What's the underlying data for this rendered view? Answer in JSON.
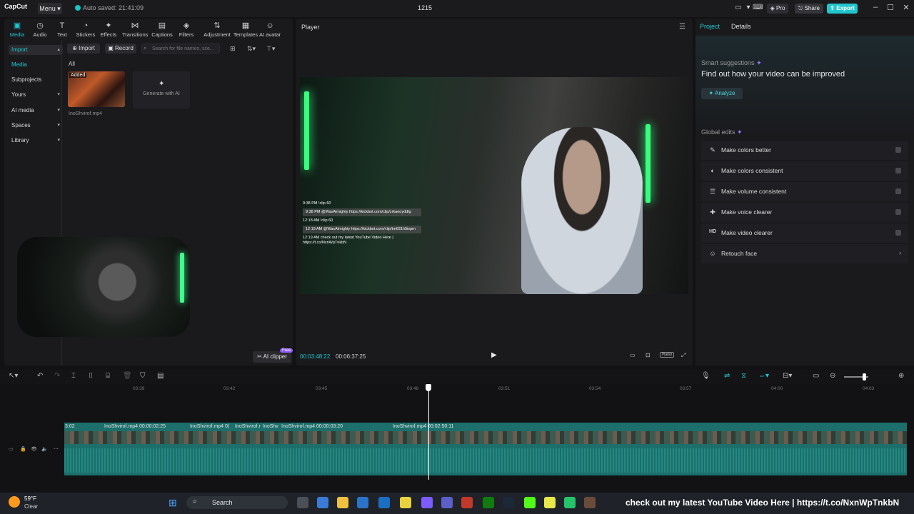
{
  "titlebar": {
    "logo": "CapCut",
    "menu": "Menu",
    "autosave": "Auto saved: 21:41:09",
    "project_name": "1215",
    "pro": "Pro",
    "share": "Share",
    "export": "Export"
  },
  "toolbar_tabs": [
    "Media",
    "Audio",
    "Text",
    "Stickers",
    "Effects",
    "Transitions",
    "Captions",
    "Filters",
    "Adjustment",
    "Templates",
    "AI avatar"
  ],
  "sidebar": {
    "items": [
      "Import",
      "Media",
      "Subprojects",
      "Yours",
      "AI media",
      "Spaces",
      "Library"
    ]
  },
  "media": {
    "import_btn": "Import",
    "record_btn": "Record",
    "search_placeholder": "Search for file names, sce...",
    "all_label": "All",
    "added_badge": "Added",
    "generate_ai": "Generate with AI",
    "file_name": "InoShvirof.mp4",
    "ai_clipper": "AI clipper",
    "free_badge": "Free"
  },
  "player": {
    "title": "Player",
    "current_time": "00:03:48:22",
    "total_time": "00:06:37:25",
    "ratio": "Ratio",
    "chat": [
      {
        "text": "9:38 PM  !clip 60",
        "boxed": false
      },
      {
        "text": "9:38 PM @WaxAlmighty https://kickbot.com/clip/zrkaeoyddlg",
        "boxed": true
      },
      {
        "text": "12:18 AM  !clip 60",
        "boxed": false
      },
      {
        "text": "12:19 AM @WaxAlmighty https://kickbot.com/clip/tm631h5isprn",
        "boxed": true
      },
      {
        "text": "12:19 AM  check out my latest YouTube Video Here | https://t.co/NxnWpTnkbN",
        "boxed": false
      }
    ]
  },
  "right_panel": {
    "tab_project": "Project",
    "tab_details": "Details",
    "smart_suggestions": "Smart suggestions",
    "find_out": "Find out how your video can be improved",
    "analyze": "Analyze",
    "global_edits": "Global edits",
    "edits": [
      {
        "icon": "✎",
        "label": "Make colors better"
      },
      {
        "icon": "◐",
        "label": "Make colors consistent"
      },
      {
        "icon": "☰",
        "label": "Make volume consistent"
      },
      {
        "icon": "✚",
        "label": "Make voice clearer"
      },
      {
        "icon": "HD",
        "label": "Make video clearer"
      },
      {
        "icon": "☺",
        "label": "Retouch face"
      }
    ]
  },
  "timeline": {
    "ruler": [
      "03:39",
      "03:42",
      "03:45",
      "03:48",
      "03:51",
      "03:54",
      "03:57",
      "04:00",
      "04:03"
    ],
    "clips": [
      {
        "label": "3:02"
      },
      {
        "label": "InoShvirof.mp4  00:00:02:25"
      },
      {
        "label": "InoShvirof.mp4  0("
      },
      {
        "label": "InoShvirof.r"
      },
      {
        "label": "InoShv"
      },
      {
        "label": "InoShvirof.mp4  00:00:03:20"
      },
      {
        "label": "InoShvirof.mp4  00:02:50:11"
      }
    ]
  },
  "taskbar": {
    "temp": "59°F",
    "condition": "Clear",
    "search": "Search",
    "ticker": "check out my latest YouTube Video Here  |  https://t.co/NxnWpTnkbN"
  }
}
